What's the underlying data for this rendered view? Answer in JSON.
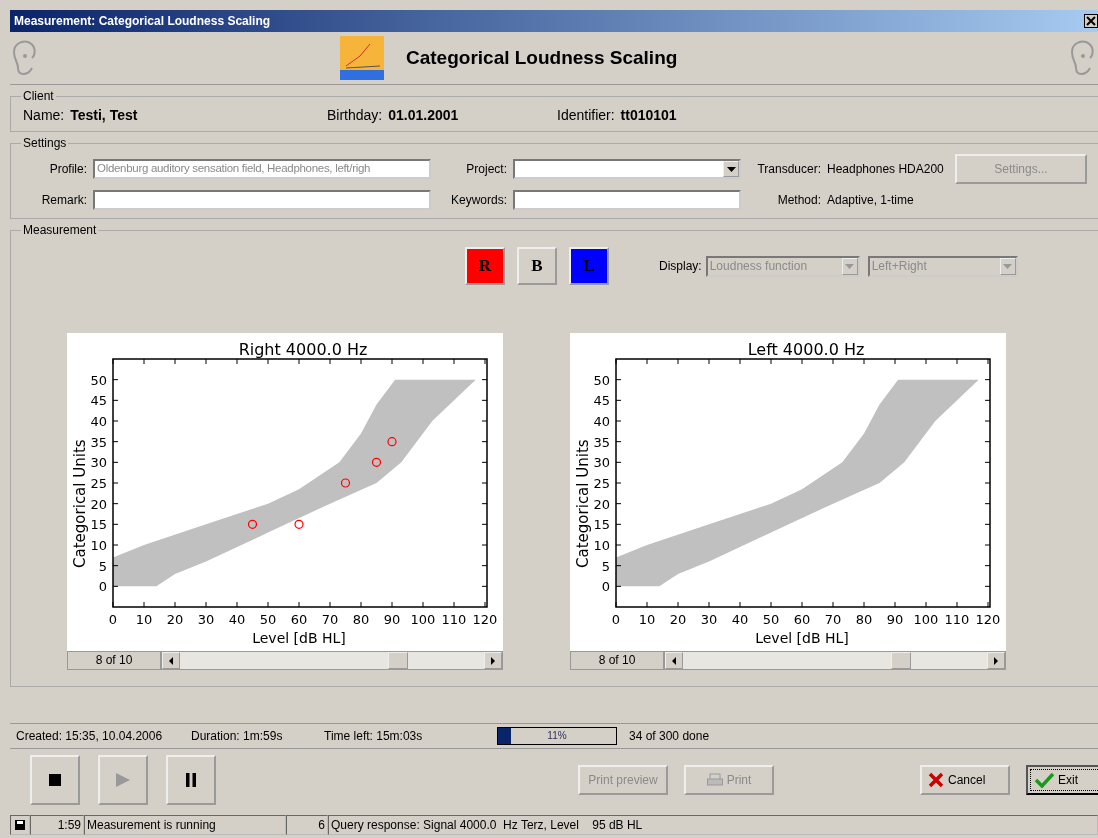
{
  "window": {
    "title": "Measurement: Categorical Loudness Scaling"
  },
  "header": {
    "title": "Categorical Loudness Scaling"
  },
  "client": {
    "legend": "Client",
    "fields": [
      {
        "label": "Name:",
        "value": "Testi, Test"
      },
      {
        "label": "Birthday:",
        "value": "01.01.2001"
      },
      {
        "label": "Identifier:",
        "value": "tt010101"
      }
    ]
  },
  "settings": {
    "legend": "Settings",
    "profile": {
      "label": "Profile:",
      "value": "Oldenburg auditory sensation field, Headphones, left/righ",
      "disabled": true
    },
    "project": {
      "label": "Project:"
    },
    "remark": {
      "label": "Remark:"
    },
    "keywords": {
      "label": "Keywords:"
    },
    "transducer": {
      "label": "Transducer:",
      "value": "Headphones HDA200"
    },
    "method": {
      "label": "Method:",
      "value": "Adaptive, 1-time"
    },
    "settings_button": {
      "label": "Settings...",
      "disabled": true
    }
  },
  "measurement": {
    "legend": "Measurement",
    "ear_buttons": [
      {
        "label": "R",
        "color": "#ff0000"
      },
      {
        "label": "B",
        "color": "#d4d0c8"
      },
      {
        "label": "L",
        "color": "#0000ff"
      }
    ],
    "display": {
      "label": "Display:",
      "dropdowns": [
        {
          "value": "Loudness function",
          "disabled": true
        },
        {
          "value": "Left+Right",
          "disabled": true
        }
      ]
    },
    "plots": [
      {
        "page": "8 of 10",
        "chart_data": {
          "type": "scatter",
          "title": "Right 4000.0 Hz",
          "xlabel": "Level [dB HL]",
          "ylabel": "Categorical Units",
          "xlim": [
            0,
            120
          ],
          "ylim": [
            -5,
            55
          ],
          "xticks": [
            0,
            10,
            20,
            30,
            40,
            50,
            60,
            70,
            80,
            90,
            100,
            110,
            120
          ],
          "yticks": [
            0,
            5,
            10,
            15,
            20,
            25,
            30,
            35,
            40,
            45,
            50
          ],
          "series": [
            {
              "color": "#ff0000",
              "x": [
                45,
                60,
                75,
                85,
                90
              ],
              "values": [
                15,
                15,
                25,
                30,
                35
              ]
            }
          ]
        }
      },
      {
        "page": "8 of 10",
        "chart_data": {
          "type": "scatter",
          "title": "Left 4000.0 Hz",
          "xlabel": "Level [dB HL]",
          "ylabel": "Categorical Units",
          "xlim": [
            0,
            120
          ],
          "ylim": [
            -5,
            55
          ],
          "xticks": [
            0,
            10,
            20,
            30,
            40,
            50,
            60,
            70,
            80,
            90,
            100,
            110,
            120
          ],
          "yticks": [
            0,
            5,
            10,
            15,
            20,
            25,
            30,
            35,
            40,
            45,
            50
          ]
        }
      }
    ]
  },
  "info": {
    "created": "Created: 15:35, 10.04.2006",
    "duration": "Duration: 1m:59s",
    "time_left": "Time left: 15m:03s",
    "progress": {
      "level": 0.11,
      "label": "11%"
    },
    "done": "34 of 300 done"
  },
  "transport": [
    {
      "kind": "stop",
      "disabled": false
    },
    {
      "kind": "play",
      "disabled": true
    },
    {
      "kind": "pause",
      "disabled": false
    }
  ],
  "actions": [
    {
      "kind": "preview",
      "label": "Print preview",
      "disabled": true
    },
    {
      "kind": "print",
      "label": "Print",
      "disabled": true
    },
    {
      "kind": "cancel",
      "label": "Cancel",
      "disabled": false
    },
    {
      "kind": "exit",
      "label": "Exit",
      "disabled": false
    }
  ],
  "status_bar": [
    "1:59",
    "Measurement is running",
    "6",
    "Query response: Signal 4000.0  Hz Terz, Level    95 dB HL"
  ]
}
